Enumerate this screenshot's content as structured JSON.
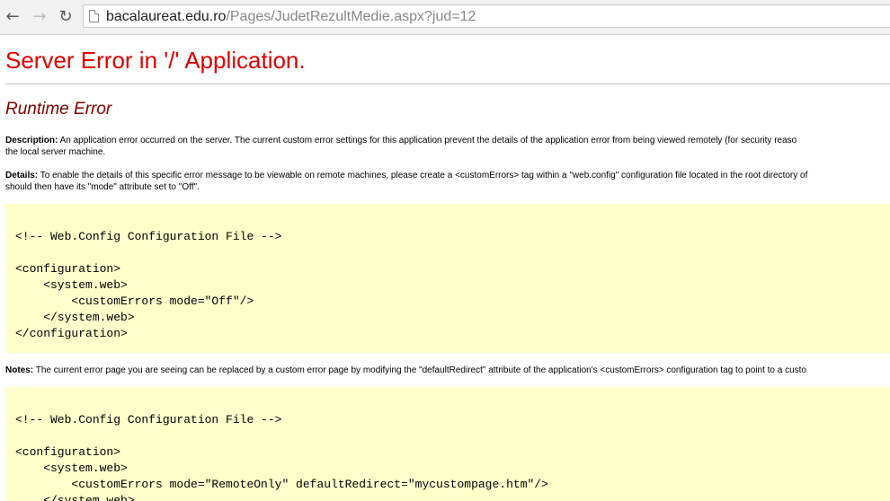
{
  "browser": {
    "url_host": "bacalaureat.edu.ro",
    "url_path": "/Pages/JudetRezultMedie.aspx?jud=12"
  },
  "page": {
    "title": "Server Error in '/' Application.",
    "subtitle": "Runtime Error",
    "description_label": "Description:",
    "description_text_1": " An application error occurred on the server. The current custom error settings for this application prevent the details of the application error from being viewed remotely (for security reaso",
    "description_text_2": "the local server machine.",
    "details_label": "Details:",
    "details_text_1": " To enable the details of this specific error message to be viewable on remote machines, please create a <customErrors> tag within a \"web.config\" configuration file located in the root directory of",
    "details_text_2": "should then have its \"mode\" attribute set to \"Off\".",
    "code1": "<!-- Web.Config Configuration File -->\n\n<configuration>\n    <system.web>\n        <customErrors mode=\"Off\"/>\n    </system.web>\n</configuration>",
    "notes_label": "Notes:",
    "notes_text": " The current error page you are seeing can be replaced by a custom error page by modifying the \"defaultRedirect\" attribute of the application's <customErrors> configuration tag to point to a custo",
    "code2": "<!-- Web.Config Configuration File -->\n\n<configuration>\n    <system.web>\n        <customErrors mode=\"RemoteOnly\" defaultRedirect=\"mycustompage.htm\"/>\n    </system.web>"
  },
  "colors": {
    "title": "#e00000",
    "subtitle": "#800000",
    "code_background": "#ffffcc"
  },
  "icons": {
    "back": "arrow-left-icon",
    "forward": "arrow-right-icon",
    "reload": "reload-icon",
    "page": "page-icon"
  }
}
